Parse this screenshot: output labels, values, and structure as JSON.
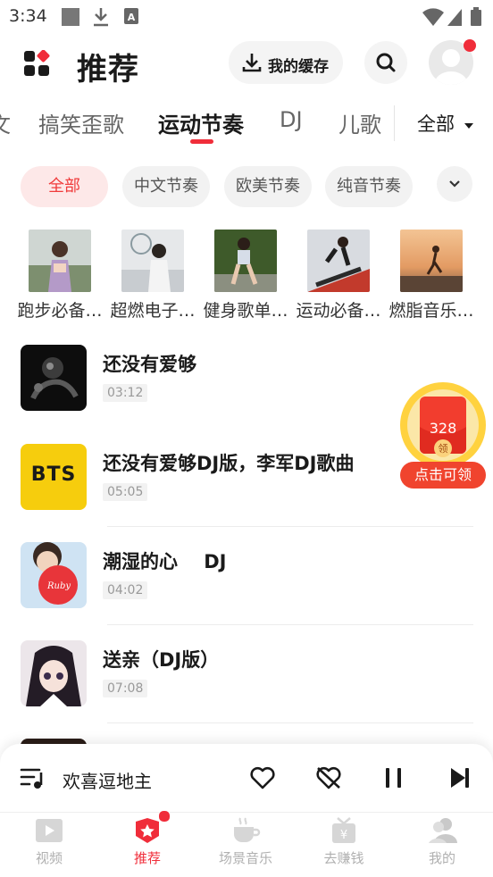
{
  "status_bar": {
    "time": "3:34"
  },
  "header": {
    "title": "推荐",
    "cache_label": "我的缓存"
  },
  "categories": {
    "items": [
      "文",
      "搞笑歪歌",
      "运动节奏",
      "DJ",
      "儿歌"
    ],
    "all_label": "全部"
  },
  "chips": [
    "全部",
    "中文节奏",
    "欧美节奏",
    "纯音节奏"
  ],
  "playlists": [
    "跑步必备…",
    "超燃电子…",
    "健身歌单…",
    "运动必备…",
    "燃脂音乐…"
  ],
  "songs": [
    {
      "title": "还没有爱够",
      "duration": "03:12",
      "art_text": ""
    },
    {
      "title": "还没有爱够DJ版，李军DJ歌曲",
      "duration": "05:05",
      "art_text": "BTS"
    },
    {
      "title": "潮湿的心    DJ",
      "duration": "04:02",
      "art_text": "Ruby"
    },
    {
      "title": "送亲（DJ版）",
      "duration": "07:08",
      "art_text": ""
    }
  ],
  "red_packet": {
    "amount": "328",
    "badge": "领",
    "cta": "点击可领"
  },
  "player": {
    "now_playing": "欢喜逗地主"
  },
  "nav": [
    {
      "label": "视频",
      "icon": "video-icon"
    },
    {
      "label": "推荐",
      "icon": "recommend-icon"
    },
    {
      "label": "场景音乐",
      "icon": "coffee-icon"
    },
    {
      "label": "去赚钱",
      "icon": "gift-icon"
    },
    {
      "label": "我的",
      "icon": "profile-icon"
    }
  ],
  "colors": {
    "accent": "#f02d3a",
    "chip_active_bg": "#fde8e8",
    "bts_yellow": "#f6cd0d"
  }
}
